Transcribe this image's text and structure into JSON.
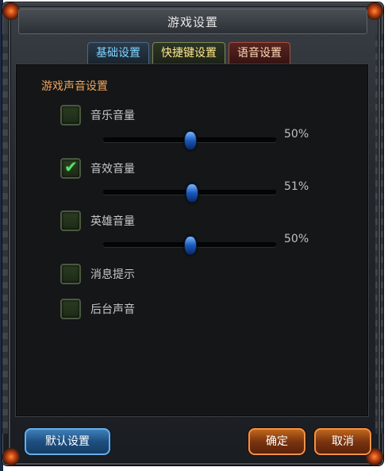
{
  "window": {
    "title": "游戏设置"
  },
  "tabs": [
    {
      "label": "基础设置"
    },
    {
      "label": "快捷键设置"
    },
    {
      "label": "语音设置"
    }
  ],
  "section": {
    "title": "游戏声音设置"
  },
  "options": {
    "music": {
      "label": "音乐音量",
      "checked": false,
      "value_label": "50%",
      "value": 0.5
    },
    "sfx": {
      "label": "音效音量",
      "checked": true,
      "value_label": "51%",
      "value": 0.51
    },
    "hero": {
      "label": "英雄音量",
      "checked": false,
      "value_label": "50%",
      "value": 0.5
    },
    "notify": {
      "label": "消息提示",
      "checked": false
    },
    "background": {
      "label": "后台声音",
      "checked": false
    }
  },
  "buttons": {
    "default_label": "默认设置",
    "confirm_label": "确定",
    "cancel_label": "取消"
  },
  "colors": {
    "accent_orange": "#f1a55a",
    "check_green": "#5ee06a",
    "slider_blue": "#1a58b8"
  }
}
